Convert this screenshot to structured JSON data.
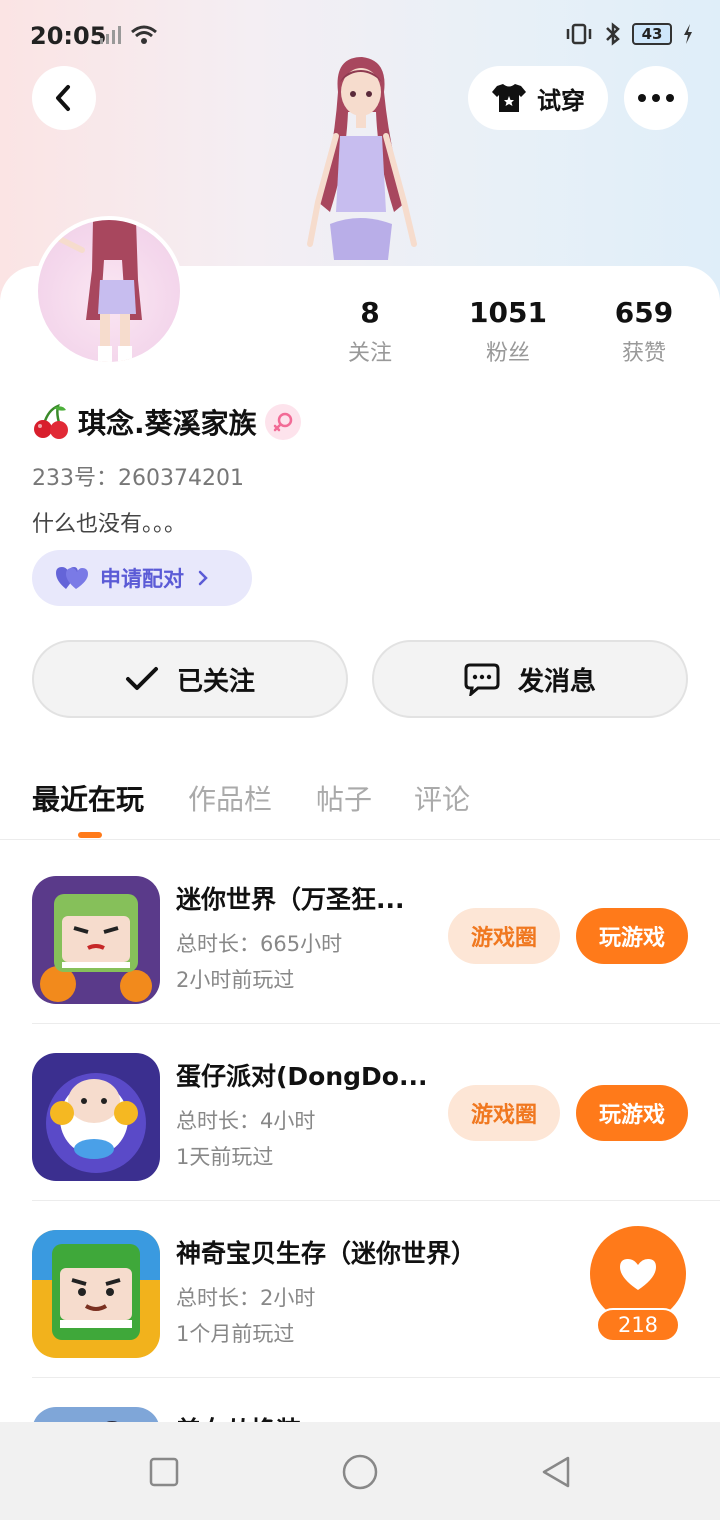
{
  "status_bar": {
    "time": "20:05",
    "battery": "43"
  },
  "header": {
    "tryon_label": "试穿"
  },
  "profile": {
    "stats": [
      {
        "value": "8",
        "label": "关注"
      },
      {
        "value": "1051",
        "label": "粉丝"
      },
      {
        "value": "659",
        "label": "获赞"
      }
    ],
    "username": "琪念.葵溪家族",
    "user_id": "233号：260374201",
    "bio": "什么也没有。。。",
    "pair_label": "申请配对"
  },
  "actions": {
    "following_label": "已关注",
    "message_label": "发消息"
  },
  "tabs": [
    "最近在玩",
    "作品栏",
    "帖子",
    "评论"
  ],
  "games": [
    {
      "title": "迷你世界（万圣狂...",
      "duration": "总时长：665小时",
      "last_played": "2小时前玩过",
      "circle_label": "游戏圈",
      "play_label": "玩游戏"
    },
    {
      "title": "蛋仔派对(DongDo...",
      "duration": "总时长：4小时",
      "last_played": "1天前玩过",
      "circle_label": "游戏圈",
      "play_label": "玩游戏"
    },
    {
      "title": "神奇宝贝生存（迷你世界）",
      "duration": "总时长：2小时",
      "last_played": "1个月前玩过"
    },
    {
      "title": "美女从换装"
    }
  ],
  "like_float": {
    "count": "218"
  }
}
